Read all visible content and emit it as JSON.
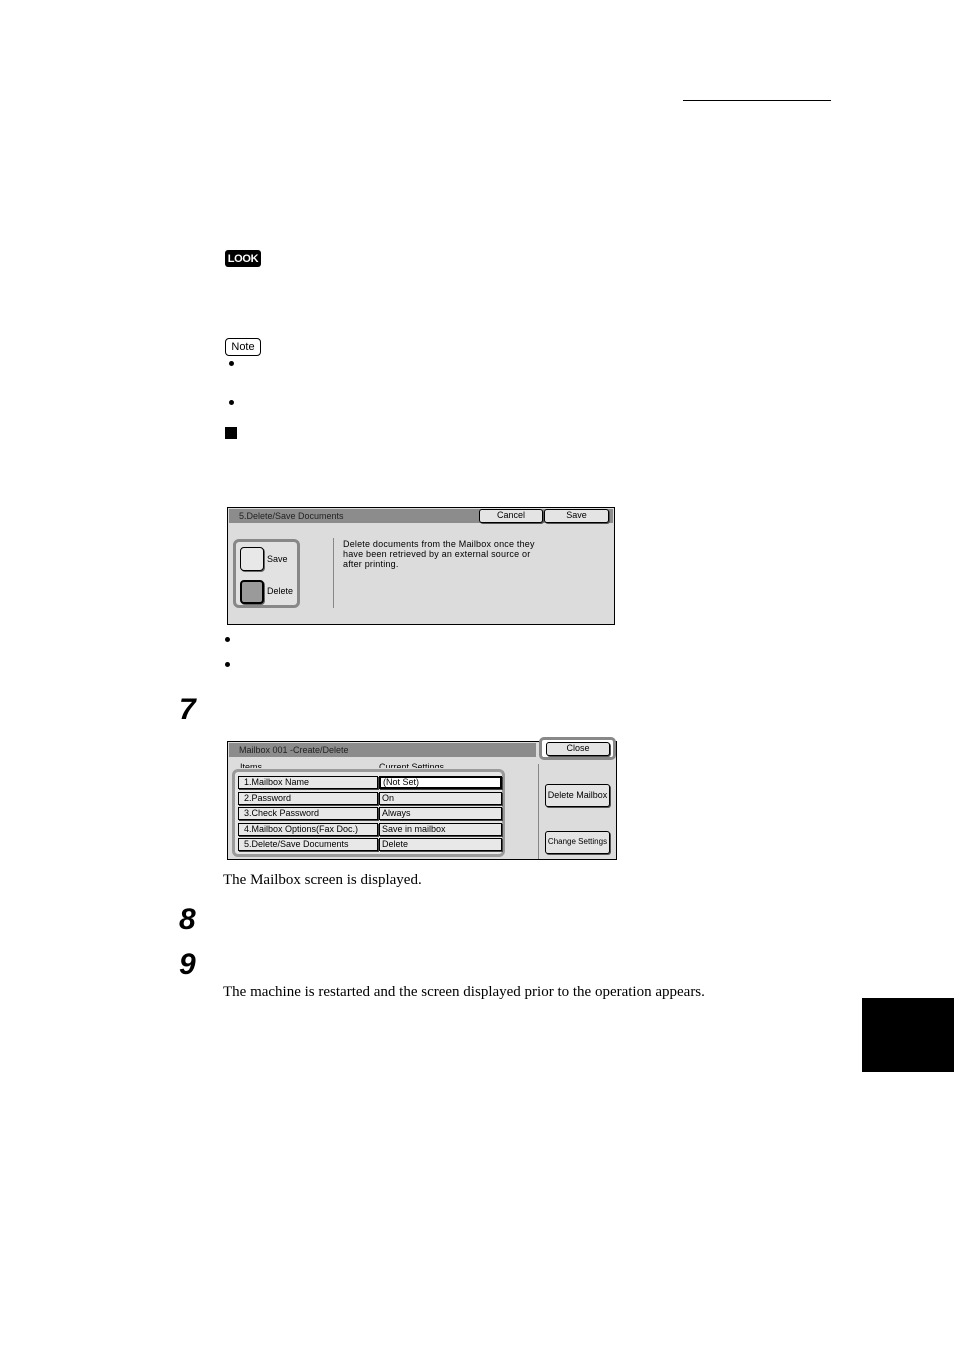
{
  "page": {
    "look_label": "LOOK",
    "note_label": "Note",
    "steps": [
      {
        "number": "7"
      },
      {
        "number": "8"
      },
      {
        "number": "9"
      }
    ],
    "step7_text": "The Mailbox screen is displayed.",
    "step9_text": "The machine is restarted and the screen displayed prior to the operation appears."
  },
  "delete_save_dialog": {
    "title": "5.Delete/Save Documents",
    "cancel_label": "Cancel",
    "save_label": "Save",
    "options": [
      {
        "label": "Save",
        "selected": false
      },
      {
        "label": "Delete",
        "selected": true
      }
    ],
    "description": "Delete documents from the Mailbox once they have been retrieved by an external source or after printing."
  },
  "mailbox_dialog": {
    "title": "Mailbox 001 -Create/Delete",
    "close_label": "Close",
    "col_items": "Items",
    "col_settings": "Current Settings",
    "rows": [
      {
        "item": "1.Mailbox Name",
        "value": "(Not Set)"
      },
      {
        "item": "2.Password",
        "value": "On"
      },
      {
        "item": "3.Check Password",
        "value": "Always"
      },
      {
        "item": "4.Mailbox Options(Fax Doc.)",
        "value": "Save in mailbox"
      },
      {
        "item": "5.Delete/Save Documents",
        "value": "Delete"
      }
    ],
    "delete_mailbox_label": "Delete Mailbox",
    "change_settings_label": "Change Settings"
  }
}
